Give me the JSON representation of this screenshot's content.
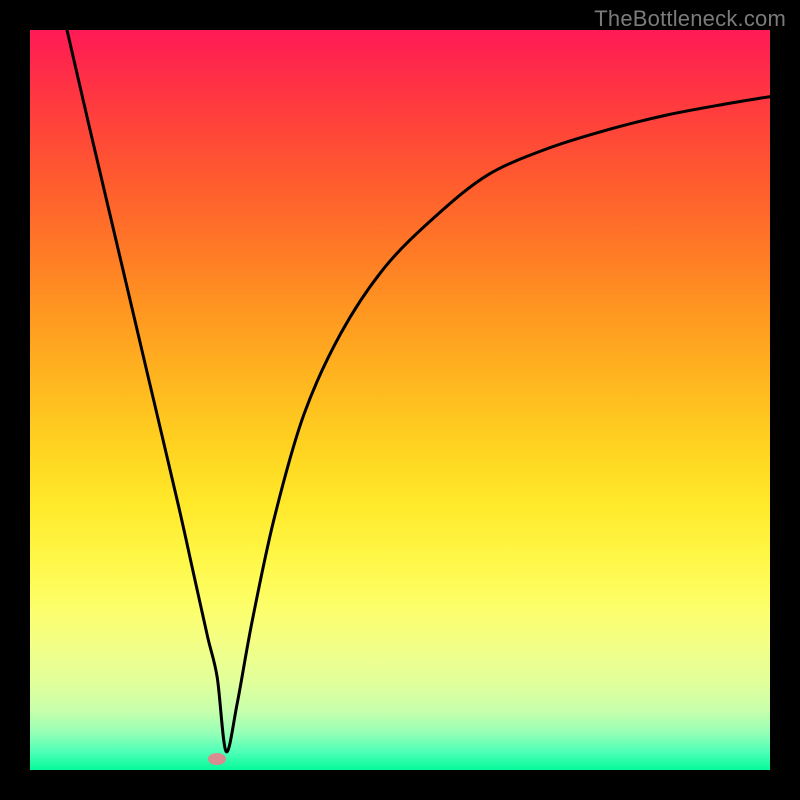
{
  "attribution": "TheBottleneck.com",
  "chart_data": {
    "type": "line",
    "title": "",
    "xlabel": "",
    "ylabel": "",
    "xlim": [
      0,
      100
    ],
    "ylim": [
      0,
      100
    ],
    "grid": false,
    "legend": false,
    "background_gradient": {
      "top": "#ff1a55",
      "bottom": "#05fa9a",
      "semantics": "red=high bottleneck, green=low bottleneck"
    },
    "series": [
      {
        "name": "bottleneck-curve",
        "color": "#000000",
        "x": [
          5,
          8,
          12,
          16,
          20,
          22,
          24,
          25.3,
          26.5,
          28,
          30,
          33,
          37,
          42,
          48,
          55,
          62,
          70,
          78,
          86,
          94,
          100
        ],
        "values": [
          100,
          87,
          70,
          53,
          36,
          27,
          18,
          12.5,
          2.5,
          9,
          20,
          34,
          48,
          59,
          68,
          75,
          80.5,
          84,
          86.5,
          88.5,
          90,
          91
        ]
      }
    ],
    "marker": {
      "name": "optimal-point",
      "x": 25.3,
      "y": 1.5,
      "color": "#d98b8f"
    }
  }
}
